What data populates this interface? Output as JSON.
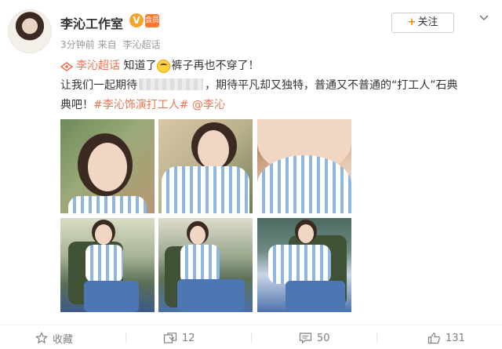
{
  "author": {
    "name": "李沁工作室",
    "verified_badge": "V",
    "vip_badge": "会员"
  },
  "meta": {
    "time": "3分钟前",
    "source_prefix": "来自",
    "source": "李沁超话"
  },
  "follow_button": {
    "label": "关注",
    "plus": "+"
  },
  "content": {
    "topic": "李沁超话",
    "line1_a": "知道了",
    "line1_b": "裤子再也不穿了！",
    "line2_a": "让我们一起期待",
    "line2_b": "，期待平凡却又独特，普通又不普通的“打工人”石典",
    "line3_a": "典吧！",
    "hashtag": "#李沁饰演打工人#",
    "mention": "@李沁"
  },
  "actions": {
    "favorite_label": "收藏",
    "repost_count": "12",
    "comment_count": "50",
    "like_count": "131"
  },
  "colors": {
    "accent": "#eb7350",
    "follow_plus": "#ff8200",
    "muted": "#808080"
  }
}
